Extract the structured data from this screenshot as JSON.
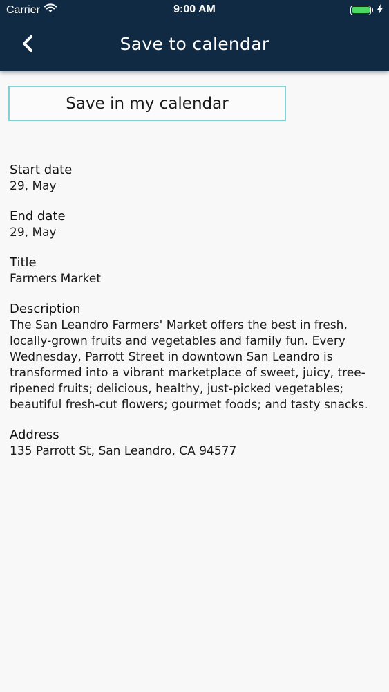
{
  "status_bar": {
    "carrier": "Carrier",
    "time": "9:00 AM",
    "icons": [
      "wifi-icon",
      "battery-icon",
      "charging-bolt-icon"
    ],
    "battery_color": "#4cd964"
  },
  "nav": {
    "back_icon": "chevron-left-icon",
    "title": "Save to calendar",
    "background": "#0f2a42"
  },
  "action": {
    "save_label": "Save in my calendar",
    "border_color": "#7fd3d3"
  },
  "event": {
    "start_label": "Start date",
    "start_value": "29, May",
    "end_label": "End date",
    "end_value": "29, May",
    "title_label": "Title",
    "title_value": "Farmers Market",
    "description_label": "Description",
    "description_value": "The San Leandro Farmers' Market offers the best in fresh, locally-grown fruits and vegetables and family fun. Every Wednesday, Parrott Street in downtown San Leandro is transformed into a vibrant marketplace of sweet, juicy, tree-ripened fruits; delicious, healthy, just-picked vegetables; beautiful fresh-cut flowers; gourmet foods; and tasty snacks.",
    "address_label": "Address",
    "address_value": "135 Parrott St, San Leandro, CA 94577"
  }
}
